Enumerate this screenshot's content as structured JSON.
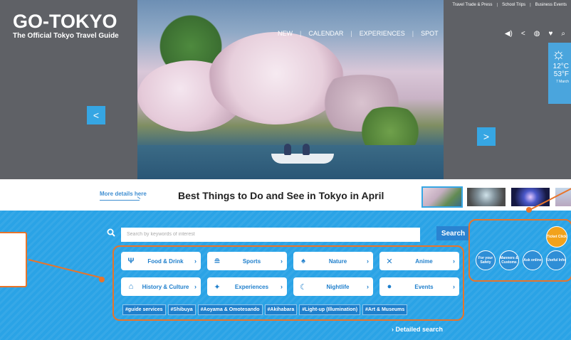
{
  "brand": {
    "logo": "GO-TOKYO",
    "subtitle": "The Official Tokyo Travel Guide"
  },
  "utility_nav": [
    "Travel Trade & Press",
    "School Trips",
    "Business Events"
  ],
  "utility_sep": "|",
  "main_nav": [
    "NEW",
    "CALENDAR",
    "EXPERIENCES",
    "SPOT"
  ],
  "nav_sep": "|",
  "icons": [
    "speaker-icon",
    "share-icon",
    "globe-icon",
    "heart-icon",
    "search-icon"
  ],
  "weather": {
    "celsius": "12°C",
    "fahrenheit": "53°F",
    "date": "7 March"
  },
  "slider": {
    "prev": "<",
    "next": ">"
  },
  "feature": {
    "more_link": "More details here",
    "title": "Best Things to Do and See in Tokyo in April"
  },
  "search": {
    "placeholder": "Search by keywords of interest",
    "button": "Search"
  },
  "categories": [
    {
      "label": "Food & Drink",
      "icon": "fork-knife-icon"
    },
    {
      "label": "Sports",
      "icon": "stadium-icon"
    },
    {
      "label": "Nature",
      "icon": "trees-icon"
    },
    {
      "label": "Anime",
      "icon": "anime-icon"
    },
    {
      "label": "History & Culture",
      "icon": "temple-icon"
    },
    {
      "label": "Experiences",
      "icon": "sparkle-person-icon"
    },
    {
      "label": "Nightlife",
      "icon": "moon-icon"
    },
    {
      "label": "Events",
      "icon": "balloon-icon"
    }
  ],
  "tags": [
    "#guide services",
    "#Shibuya",
    "#Aoyama & Omotesando",
    "#Akihabara",
    "#Light-up (Illumination)",
    "#Art & Museums"
  ],
  "detailed_search": "Detailed search",
  "help_buttons": [
    "For your Safety",
    "Manners & Customs",
    "Ask online",
    "Useful Info"
  ],
  "ticket": "Ticket Click",
  "colors": {
    "primary_blue": "#2aa3e6",
    "dark_blue": "#1f7fcc",
    "callout_orange": "#e8742a",
    "ticket_orange": "#f2a21c"
  }
}
